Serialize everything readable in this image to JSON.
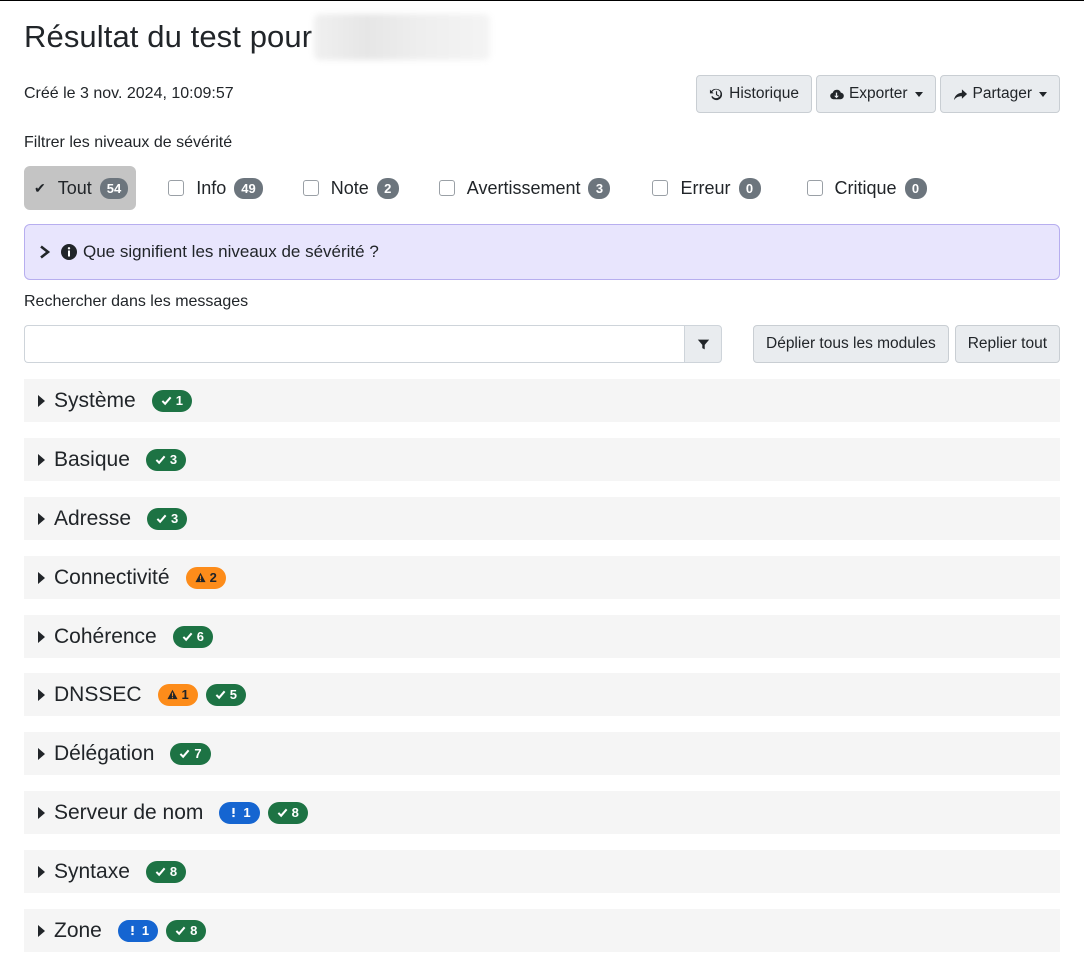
{
  "header": {
    "title": "Résultat du test pour",
    "created": "Créé le 3 nov. 2024, 10:09:57",
    "buttons": {
      "history": "Historique",
      "export": "Exporter",
      "share": "Partager"
    }
  },
  "filters": {
    "label": "Filtrer les niveaux de sévérité",
    "items": [
      {
        "label": "Tout",
        "count": "54"
      },
      {
        "label": "Info",
        "count": "49"
      },
      {
        "label": "Note",
        "count": "2"
      },
      {
        "label": "Avertissement",
        "count": "3"
      },
      {
        "label": "Erreur",
        "count": "0"
      },
      {
        "label": "Critique",
        "count": "0"
      }
    ]
  },
  "severity_help": "Que signifient les niveaux de sévérité ?",
  "search": {
    "label": "Rechercher dans les messages",
    "placeholder": "",
    "expand_all": "Déplier tous les modules",
    "collapse_all": "Replier tout"
  },
  "modules": [
    {
      "name": "Système",
      "ok": "1"
    },
    {
      "name": "Basique",
      "ok": "3"
    },
    {
      "name": "Adresse",
      "ok": "3"
    },
    {
      "name": "Connectivité",
      "warn": "2"
    },
    {
      "name": "Cohérence",
      "ok": "6"
    },
    {
      "name": "DNSSEC",
      "warn": "1",
      "ok": "5"
    },
    {
      "name": "Délégation",
      "ok": "7"
    },
    {
      "name": "Serveur de nom",
      "note": "1",
      "ok": "8"
    },
    {
      "name": "Syntaxe",
      "ok": "8"
    },
    {
      "name": "Zone",
      "note": "1",
      "ok": "8"
    }
  ],
  "colors": {
    "ok": "#1d7344",
    "warn": "#fd8c1a",
    "note": "#1565d1",
    "count": "#6c757d",
    "alert_bg": "#e8e5fd"
  }
}
